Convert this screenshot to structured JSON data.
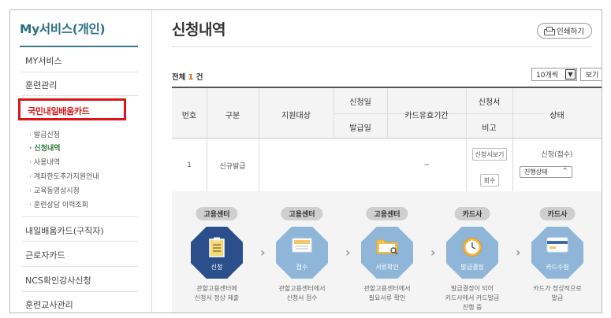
{
  "sidebar": {
    "title": "My서비스(개인)",
    "items": [
      {
        "label": "MY서비스"
      },
      {
        "label": "훈련관리"
      },
      {
        "label": "국민내일배움카드"
      },
      {
        "label": "내일배움카드(구직자)"
      },
      {
        "label": "근로자카드"
      },
      {
        "label": "NCS확인강사신청"
      },
      {
        "label": "훈련교사관리"
      }
    ],
    "sub_items": [
      {
        "label": "발급신청"
      },
      {
        "label": "신청내역"
      },
      {
        "label": "사용내역"
      },
      {
        "label": "계좌한도추가지원안내"
      },
      {
        "label": "교육동영상시청"
      },
      {
        "label": "훈련상담 이력조회"
      }
    ]
  },
  "main": {
    "title": "신청내역",
    "print_label": "인쇄하기",
    "total_label": "전체",
    "total_count": "1",
    "total_unit": "건",
    "page_size": "10개씩",
    "view_label": "보기"
  },
  "table": {
    "headers": {
      "no": "번호",
      "type": "구분",
      "target": "지원대상",
      "apply_date": "신청일",
      "issue_date": "발급일",
      "validity": "카드유효기간",
      "application": "신청서",
      "note": "비고",
      "status": "상태"
    },
    "row": {
      "no": "1",
      "type": "신규발급",
      "target": "",
      "validity": "~",
      "view_btn": "신청서보기",
      "cancel_btn": "회수",
      "status": "신청(접수)",
      "status_select": "진행상태"
    }
  },
  "flow": {
    "steps": [
      {
        "tag": "고용센터",
        "label": "신청",
        "desc": "관할고용센터에\n신청서 정상 제출",
        "icon": "clipboard-icon"
      },
      {
        "tag": "고용센터",
        "label": "접수",
        "desc": "관할고용센터에서\n신청서 접수",
        "icon": "envelope-icon"
      },
      {
        "tag": "고용센터",
        "label": "서류확인",
        "desc": "관할고용센터에서\n필요서류 확인",
        "icon": "folder-icon"
      },
      {
        "tag": "카드사",
        "label": "발급결정",
        "desc": "발급결정이 되어\n카드사에서 카드발급\n진행 중",
        "icon": "clock-icon"
      },
      {
        "tag": "카드사",
        "label": "카드수령",
        "desc": "카드가 정상적으로\n발급",
        "icon": "card-icon"
      }
    ],
    "colors": {
      "active": "#2b4f8b",
      "inactive": "#8fb6d8",
      "highlight": "#d9161b"
    }
  }
}
